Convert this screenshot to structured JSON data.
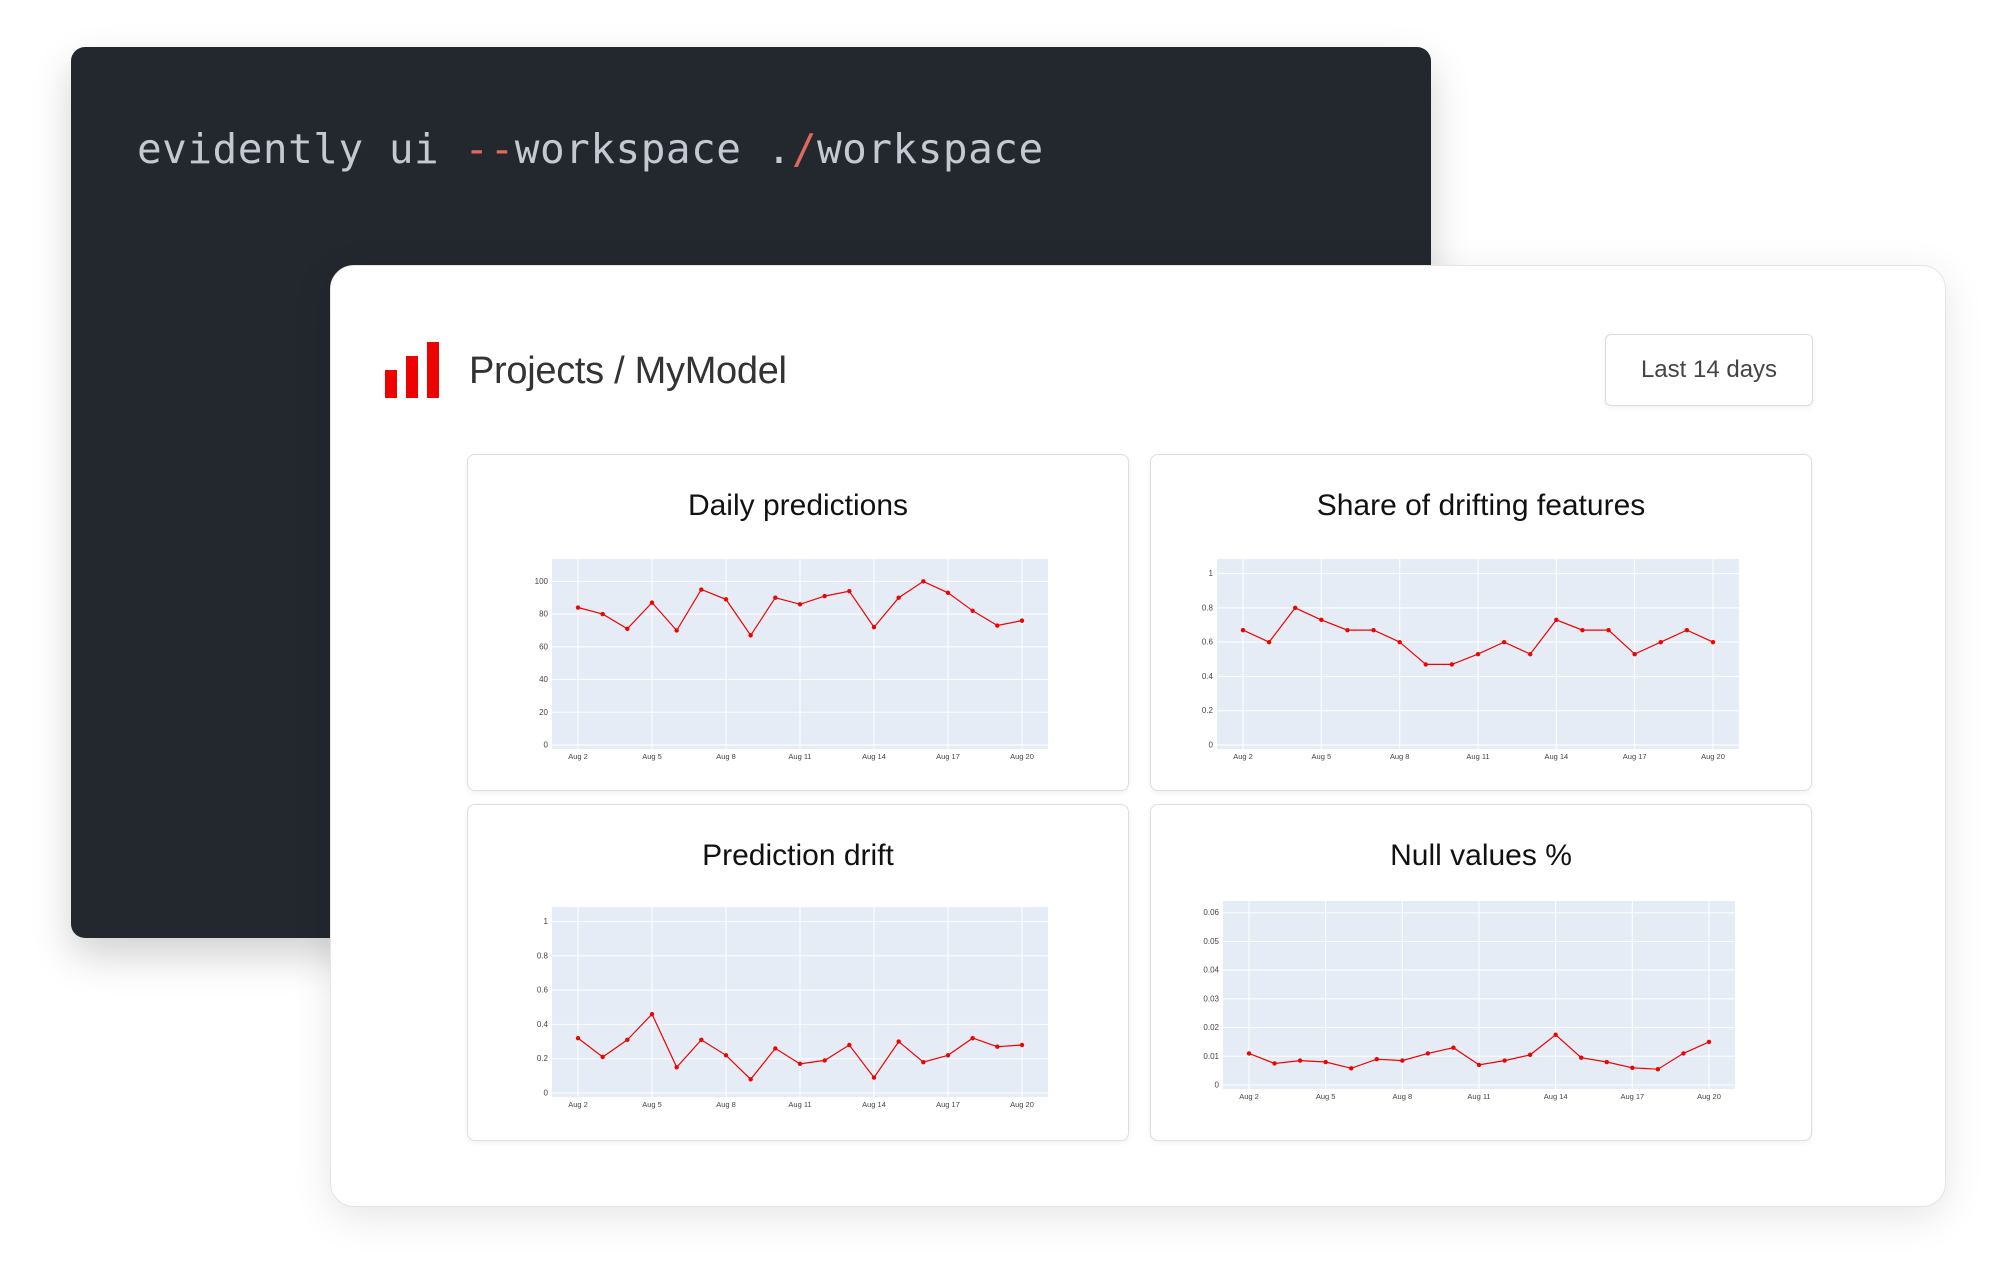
{
  "terminal": {
    "command_prefix": "evidently ui ",
    "command_flag_dashes": "--",
    "command_flag": "workspace .",
    "command_slash": "/",
    "command_arg": "workspace"
  },
  "header": {
    "breadcrumb": "Projects / MyModel",
    "logo_icon": "bar-chart-logo-icon",
    "range_label": "Last 14 days"
  },
  "colors": {
    "accent": "#ed0400",
    "plot_bg": "#e5ecf6",
    "terminal_bg": "#23272e"
  },
  "chart_data": [
    {
      "type": "line",
      "title": "Daily predictions",
      "x": [
        "Aug 2",
        "Aug 3",
        "Aug 4",
        "Aug 5",
        "Aug 6",
        "Aug 7",
        "Aug 8",
        "Aug 9",
        "Aug 10",
        "Aug 11",
        "Aug 12",
        "Aug 13",
        "Aug 14",
        "Aug 15",
        "Aug 16",
        "Aug 17",
        "Aug 18",
        "Aug 19",
        "Aug 20"
      ],
      "values": [
        84,
        80,
        71,
        87,
        70,
        95,
        89,
        67,
        90,
        86,
        91,
        94,
        72,
        90,
        100,
        93,
        82,
        73,
        76
      ],
      "xticks": [
        "Aug 2",
        "Aug 5",
        "Aug 8",
        "Aug 11",
        "Aug 14",
        "Aug 17",
        "Aug 20"
      ],
      "yticks": [
        0,
        20,
        40,
        60,
        80,
        100
      ],
      "ylim": [
        0,
        110
      ],
      "grid": true
    },
    {
      "type": "line",
      "title": "Share of drifting features",
      "x": [
        "Aug 2",
        "Aug 3",
        "Aug 4",
        "Aug 5",
        "Aug 6",
        "Aug 7",
        "Aug 8",
        "Aug 9",
        "Aug 10",
        "Aug 11",
        "Aug 12",
        "Aug 13",
        "Aug 14",
        "Aug 15",
        "Aug 16",
        "Aug 17",
        "Aug 18",
        "Aug 19",
        "Aug 20"
      ],
      "values": [
        0.67,
        0.6,
        0.8,
        0.73,
        0.67,
        0.67,
        0.6,
        0.47,
        0.47,
        0.53,
        0.6,
        0.53,
        0.73,
        0.67,
        0.67,
        0.53,
        0.6,
        0.67,
        0.6
      ],
      "xticks": [
        "Aug 2",
        "Aug 5",
        "Aug 8",
        "Aug 11",
        "Aug 14",
        "Aug 17",
        "Aug 20"
      ],
      "yticks": [
        0,
        0.2,
        0.4,
        0.6,
        0.8,
        1
      ],
      "ylim": [
        0,
        1.05
      ],
      "grid": true
    },
    {
      "type": "line",
      "title": "Prediction drift",
      "x": [
        "Aug 2",
        "Aug 3",
        "Aug 4",
        "Aug 5",
        "Aug 6",
        "Aug 7",
        "Aug 8",
        "Aug 9",
        "Aug 10",
        "Aug 11",
        "Aug 12",
        "Aug 13",
        "Aug 14",
        "Aug 15",
        "Aug 16",
        "Aug 17",
        "Aug 18",
        "Aug 19",
        "Aug 20"
      ],
      "values": [
        0.32,
        0.21,
        0.31,
        0.46,
        0.15,
        0.31,
        0.22,
        0.08,
        0.26,
        0.17,
        0.19,
        0.28,
        0.09,
        0.3,
        0.18,
        0.22,
        0.32,
        0.27,
        0.28
      ],
      "xticks": [
        "Aug 2",
        "Aug 5",
        "Aug 8",
        "Aug 11",
        "Aug 14",
        "Aug 17",
        "Aug 20"
      ],
      "yticks": [
        0,
        0.2,
        0.4,
        0.6,
        0.8,
        1
      ],
      "ylim": [
        0,
        1.05
      ],
      "grid": true
    },
    {
      "type": "line",
      "title": "Null values %",
      "x": [
        "Aug 2",
        "Aug 3",
        "Aug 4",
        "Aug 5",
        "Aug 6",
        "Aug 7",
        "Aug 8",
        "Aug 9",
        "Aug 10",
        "Aug 11",
        "Aug 12",
        "Aug 13",
        "Aug 14",
        "Aug 15",
        "Aug 16",
        "Aug 17",
        "Aug 18",
        "Aug 19",
        "Aug 20"
      ],
      "values": [
        0.011,
        0.0075,
        0.0085,
        0.008,
        0.0058,
        0.009,
        0.0085,
        0.011,
        0.013,
        0.007,
        0.0085,
        0.0105,
        0.0175,
        0.0095,
        0.008,
        0.006,
        0.0055,
        0.011,
        0.015
      ],
      "xticks": [
        "Aug 2",
        "Aug 5",
        "Aug 8",
        "Aug 11",
        "Aug 14",
        "Aug 17",
        "Aug 20"
      ],
      "yticks": [
        "0",
        "0.01",
        "0.02",
        "0.03",
        "0.04",
        "0.05",
        "0.06"
      ],
      "ylim": [
        0,
        0.062
      ],
      "grid": true
    }
  ]
}
